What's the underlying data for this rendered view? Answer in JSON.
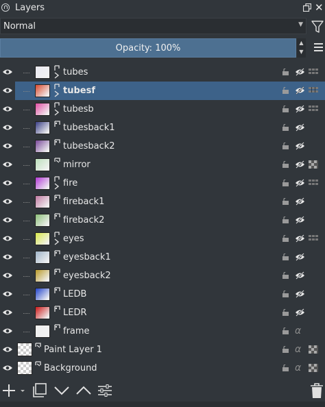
{
  "panel": {
    "title": "Layers",
    "blend_mode": "Normal",
    "opacity_label": "Opacity:  100%"
  },
  "layers": [
    {
      "name": "tubes",
      "kind": "group",
      "bold": false,
      "selected": false,
      "thumb_color": "#e9e9f2",
      "extra": "grid"
    },
    {
      "name": "tubesf",
      "kind": "group",
      "bold": true,
      "selected": true,
      "thumb_color": "#d94a2f",
      "extra": "grid"
    },
    {
      "name": "tubesb",
      "kind": "group",
      "bold": false,
      "selected": false,
      "thumb_color": "#e04fa4",
      "extra": "grid"
    },
    {
      "name": "tubesback1",
      "kind": "clone",
      "bold": false,
      "selected": false,
      "thumb_color": "#3a3f86",
      "extra": "none"
    },
    {
      "name": "tubesback2",
      "kind": "clone",
      "bold": false,
      "selected": false,
      "thumb_color": "#7a4a9a",
      "extra": "none"
    },
    {
      "name": "mirror",
      "kind": "filter",
      "bold": false,
      "selected": false,
      "thumb_color": "#bde0bd",
      "extra": "checker"
    },
    {
      "name": "fire",
      "kind": "group",
      "bold": false,
      "selected": false,
      "thumb_color": "#b23ad6",
      "extra": "grid"
    },
    {
      "name": "fireback1",
      "kind": "clone",
      "bold": false,
      "selected": false,
      "thumb_color": "#c07aa2",
      "extra": "none"
    },
    {
      "name": "fireback2",
      "kind": "clone",
      "bold": false,
      "selected": false,
      "thumb_color": "#8cbf7a",
      "extra": "none"
    },
    {
      "name": "eyes",
      "kind": "group",
      "bold": false,
      "selected": false,
      "thumb_color": "#d8e84a",
      "extra": "grid"
    },
    {
      "name": "eyesback1",
      "kind": "clone",
      "bold": false,
      "selected": false,
      "thumb_color": "#9fb4c8",
      "extra": "none"
    },
    {
      "name": "eyesback2",
      "kind": "clone",
      "bold": false,
      "selected": false,
      "thumb_color": "#b99a2a",
      "extra": "none"
    },
    {
      "name": "LEDB",
      "kind": "clone",
      "bold": false,
      "selected": false,
      "thumb_color": "#2244cc",
      "extra": "none"
    },
    {
      "name": "LEDR",
      "kind": "clone",
      "bold": false,
      "selected": false,
      "thumb_color": "#cc1a1a",
      "extra": "none"
    },
    {
      "name": "frame",
      "kind": "clone",
      "bold": false,
      "selected": false,
      "thumb_color": "#efefef",
      "extra": "alpha"
    },
    {
      "name": "Paint Layer 1",
      "kind": "paint",
      "bold": false,
      "selected": false,
      "thumb_color": "#ffffff",
      "extra": "alpha-checker",
      "root": true
    },
    {
      "name": "Background",
      "kind": "paint",
      "bold": false,
      "selected": false,
      "thumb_color": "#ffffff",
      "extra": "alpha-checker",
      "root": true
    }
  ],
  "colors": {
    "panel_bg": "#31363b",
    "selection": "#3d6289",
    "opacity_bar": "#4d7091"
  },
  "icons": {
    "title": "layers-docker-icon",
    "filter": "filter-icon",
    "menu": "hamburger-menu-icon",
    "add": "add-layer-icon",
    "duplicate": "duplicate-layer-icon",
    "move_down": "chevron-down-icon",
    "move_up": "chevron-up-icon",
    "properties": "properties-sliders-icon",
    "delete": "trash-icon"
  }
}
